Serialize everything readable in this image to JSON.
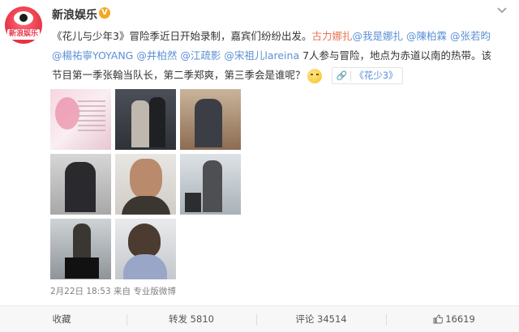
{
  "post": {
    "username": "新浪娱乐",
    "verified_mark": "V",
    "avatar_text": "新浪娱乐",
    "text_line1_a": "《花儿与少年3》冒险季近日开始录制，嘉宾们纷纷出发。",
    "mention_1": "古力娜扎",
    "mention_2": "@我是娜扎",
    "mention_3": "@陳柏霖",
    "mention_4": "@张若昀",
    "mention_5": "@楊祐寧YOYANG",
    "mention_6": "@井柏然",
    "mention_7": "@江疏影",
    "mention_8": "@宋祖儿lareina",
    "text_line2_end": "7人参与冒险，地点为赤道以南的热带。该",
    "text_line3": "节目第一季张翰当队长，第二季郑爽，第三季会是谁呢？",
    "topic_tag": "《花少3》",
    "timestamp": "2月22日 18:53",
    "source": "来自 专业版微博",
    "photos_alt": [
      "pink poster",
      "airport travelers",
      "man with backpack",
      "woman with hat",
      "man selfie",
      "man with luggage",
      "woman with suitcase",
      "woman close-up"
    ]
  },
  "footer": {
    "favorite_label": "收藏",
    "repost_label": "转发 5810",
    "comment_label": "评论 34514",
    "like_count": "16619"
  },
  "colors": {
    "mention": "#eb7350",
    "link": "#5b8fd6",
    "brand": "#e8384a"
  }
}
